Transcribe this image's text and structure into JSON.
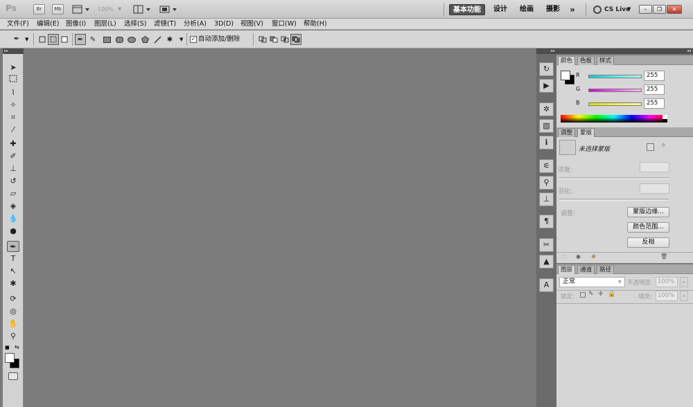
{
  "appbar": {
    "logo": "Ps",
    "br_label": "Br",
    "mb_label": "Mb",
    "zoom": "100%",
    "workspaces": [
      "基本功能",
      "设计",
      "绘画",
      "摄影"
    ],
    "more": "»",
    "cslive": "CS Live"
  },
  "menu": [
    "文件(F)",
    "编辑(E)",
    "图像(I)",
    "图层(L)",
    "选择(S)",
    "滤镜(T)",
    "分析(A)",
    "3D(D)",
    "视图(V)",
    "窗口(W)",
    "帮助(H)"
  ],
  "options": {
    "auto_add_delete": "自动添加/删除",
    "auto_add_checked": true
  },
  "color_panel": {
    "tabs": [
      "颜色",
      "色板",
      "样式"
    ],
    "channels": [
      {
        "name": "R",
        "value": "255",
        "gradient": "#00d8d8"
      },
      {
        "name": "G",
        "value": "255",
        "gradient": "#d800d8"
      },
      {
        "name": "B",
        "value": "255",
        "gradient": "#e0e000"
      }
    ]
  },
  "masks_panel": {
    "tabs": [
      "调整",
      "蒙版"
    ],
    "title": "未选择蒙版",
    "density_label": "浓度:",
    "feather_label": "羽化:",
    "refine_label": "调整:",
    "buttons": [
      "蒙版边缘...",
      "颜色范围...",
      "反相"
    ]
  },
  "layers_panel": {
    "tabs": [
      "图层",
      "通道",
      "路径"
    ],
    "blend_mode": "正常",
    "opacity_label": "不透明度:",
    "opacity": "100%",
    "lock_label": "锁定:",
    "fill_label": "填充:",
    "fill": "100%"
  }
}
